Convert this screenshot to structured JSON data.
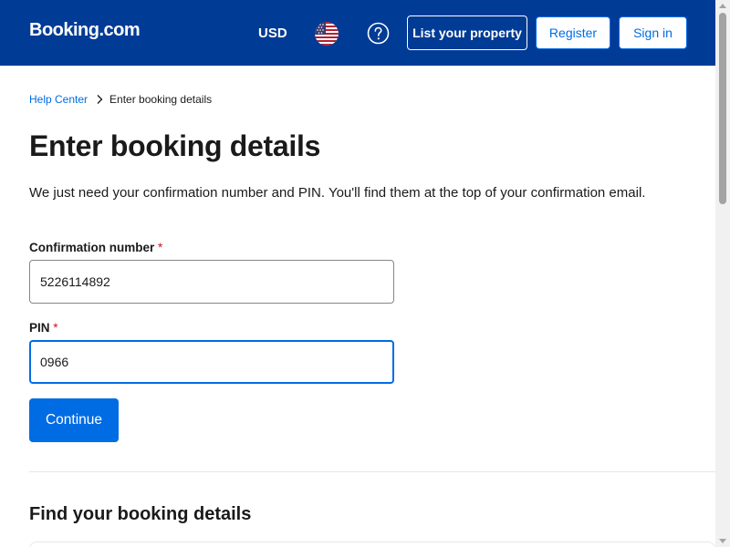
{
  "header": {
    "logo": "Booking.com",
    "currency": "USD",
    "flag_icon": "us-flag-icon",
    "help_icon": "question-circle-icon",
    "list_property_label": "List your property",
    "register_label": "Register",
    "signin_label": "Sign in",
    "colors": {
      "background": "#003b95",
      "accent": "#006ce4"
    }
  },
  "breadcrumb": {
    "link": "Help Center",
    "separator_icon": "chevron-right-icon",
    "current": "Enter booking details"
  },
  "main": {
    "title": "Enter booking details",
    "intro": "We just need your confirmation number and PIN. You'll find them at the top of your confirmation email.",
    "confirmation": {
      "label": "Confirmation number",
      "required_mark": "*",
      "value": "5226114892"
    },
    "pin": {
      "label": "PIN",
      "required_mark": "*",
      "value": "0966"
    },
    "continue_label": "Continue",
    "find_heading": "Find your booking details"
  }
}
